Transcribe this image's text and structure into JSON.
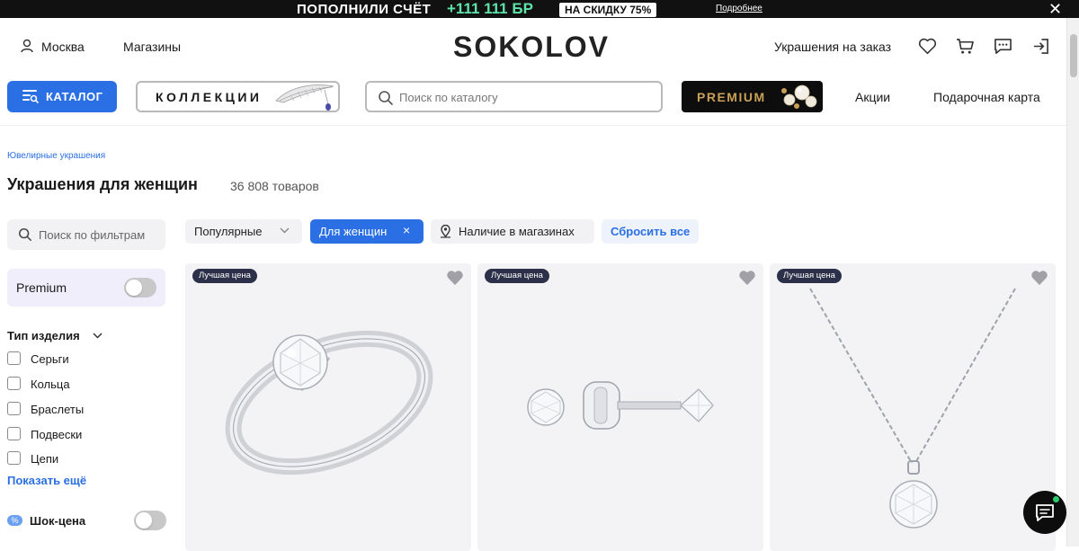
{
  "promo": {
    "text1": "ПОПОЛНИЛИ СЧЁТ",
    "text2": "+111 111 БР",
    "badge": "НА СКИДКУ 75%",
    "link": "Подробнее",
    "close": "✕"
  },
  "header": {
    "city": "Москва",
    "stores": "Магазины",
    "logo": "SOKOLOV",
    "custom": "Украшения на заказ",
    "icons": [
      "user-location-icon",
      "heart-icon",
      "cart-icon",
      "chat-icon",
      "login-icon"
    ]
  },
  "nav": {
    "catalog": "КАТАЛОГ",
    "collections": "КОЛЛЕКЦИИ",
    "search_placeholder": "Поиск по каталогу",
    "premium": "PREMIUM",
    "sales": "Акции",
    "gift_card": "Подарочная карта"
  },
  "breadcrumb": "Ювелирные украшения",
  "page": {
    "title": "Украшения для женщин",
    "count": "36 808 товаров"
  },
  "filters": {
    "search_placeholder": "Поиск по фильтрам",
    "premium_label": "Premium",
    "premium_on": false,
    "type_header": "Тип изделия",
    "types": [
      "Серьги",
      "Кольца",
      "Браслеты",
      "Подвески",
      "Цепи"
    ],
    "show_more": "Показать ещё",
    "shock_badge": "%",
    "shock_label": "Шок-цена",
    "shock_on": false
  },
  "chips": {
    "sort": "Популярные",
    "women": "Для женщин",
    "women_remove": "×",
    "availability": "Наличие в магазинах",
    "reset": "Сбросить все"
  },
  "products": [
    {
      "badge": "Лучшая цена",
      "kind": "ring"
    },
    {
      "badge": "Лучшая цена",
      "kind": "earrings"
    },
    {
      "badge": "Лучшая цена",
      "kind": "pendant"
    }
  ],
  "colors": {
    "accent": "#2a6fe3",
    "premium_gold": "#c9a055",
    "badge_bg": "#2c3149",
    "promo_green": "#5ee3a8"
  }
}
